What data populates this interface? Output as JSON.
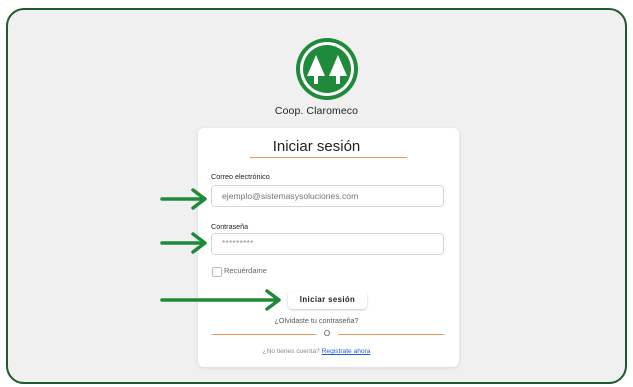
{
  "brand": {
    "name": "Coop. Claromeco",
    "logo_icon": "trees-logo-icon",
    "logo_color": "#1f8a3a"
  },
  "login_card": {
    "title": "Iniciar sesión",
    "email_label": "Correo electrónico",
    "email_placeholder": "ejemplo@sistemasysoluciones.com",
    "password_label": "Contraseña",
    "password_value": "*********",
    "remember_label": "Recuérdame",
    "remember_checked": false,
    "submit_label": "Iniciar sesión",
    "forgot_link": "¿Olvidaste tu contraseña?",
    "separator": "O",
    "signup_prompt": "¿No tienes cuenta?",
    "signup_link": "Registrate ahora"
  },
  "annotations": {
    "arrow_icon": "right-arrow-icon",
    "arrow_color": "#1f8a3a"
  },
  "colors": {
    "frame_border": "#1f5a2c",
    "accent_rule": "#e39a5e",
    "link": "#1a5fd0"
  }
}
